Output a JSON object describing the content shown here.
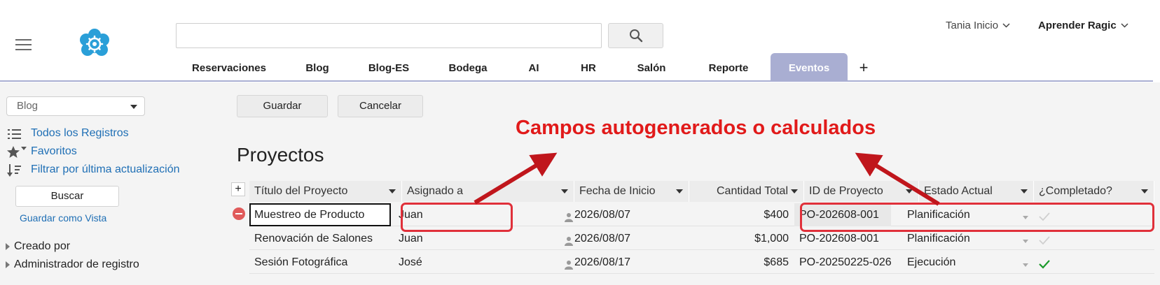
{
  "header": {
    "search": {
      "value": "",
      "placeholder": ""
    },
    "user_menu": "Tania Inicio",
    "learn_menu": "Aprender Ragic",
    "tabs": [
      {
        "label": "Reservaciones",
        "active": false
      },
      {
        "label": "Blog",
        "active": false
      },
      {
        "label": "Blog-ES",
        "active": false
      },
      {
        "label": "Bodega",
        "active": false
      },
      {
        "label": "AI",
        "active": false
      },
      {
        "label": "HR",
        "active": false
      },
      {
        "label": "Salón",
        "active": false
      },
      {
        "label": "Reporte",
        "active": false
      },
      {
        "label": "Eventos",
        "active": true
      }
    ],
    "add_tab": "+"
  },
  "sidebar": {
    "view_select": "Blog",
    "links": {
      "all_records": "Todos los Registros",
      "favorites": "Favoritos",
      "filter_last_update": "Filtrar por última actualización"
    },
    "search_button": "Buscar",
    "save_view": "Guardar como Vista",
    "tree": [
      "Creado por",
      "Administrador de registro"
    ]
  },
  "main": {
    "save_button": "Guardar",
    "cancel_button": "Cancelar",
    "title": "Proyectos",
    "columns": [
      "Título del Proyecto",
      "Asignado a",
      "Fecha de Inicio",
      "Cantidad Total",
      "ID de Proyecto",
      "Estado Actual",
      "¿Completado?"
    ],
    "rows": [
      {
        "title": "Muestreo de Producto",
        "assigned": "Juan",
        "start": "2026/08/07",
        "amount": "$400",
        "project_id": "PO-202608-001",
        "status": "Planificación",
        "completed": false
      },
      {
        "title": "Renovación de Salones",
        "assigned": "Juan",
        "start": "2026/08/07",
        "amount": "$1,000",
        "project_id": "PO-202608-001",
        "status": "Planificación",
        "completed": false
      },
      {
        "title": "Sesión Fotográfica",
        "assigned": "José",
        "start": "2026/08/17",
        "amount": "$685",
        "project_id": "PO-20250225-026",
        "status": "Ejecución",
        "completed": true
      }
    ]
  },
  "annotation": {
    "text": "Campos autogenerados o calculados",
    "color": "#e11a1a"
  },
  "colors": {
    "accent_tab": "#a9aed2",
    "link": "#1f6fb5",
    "logo": "#2a9fd8",
    "check_done": "#1a9a2a",
    "check_pending": "#cfcfcf"
  }
}
